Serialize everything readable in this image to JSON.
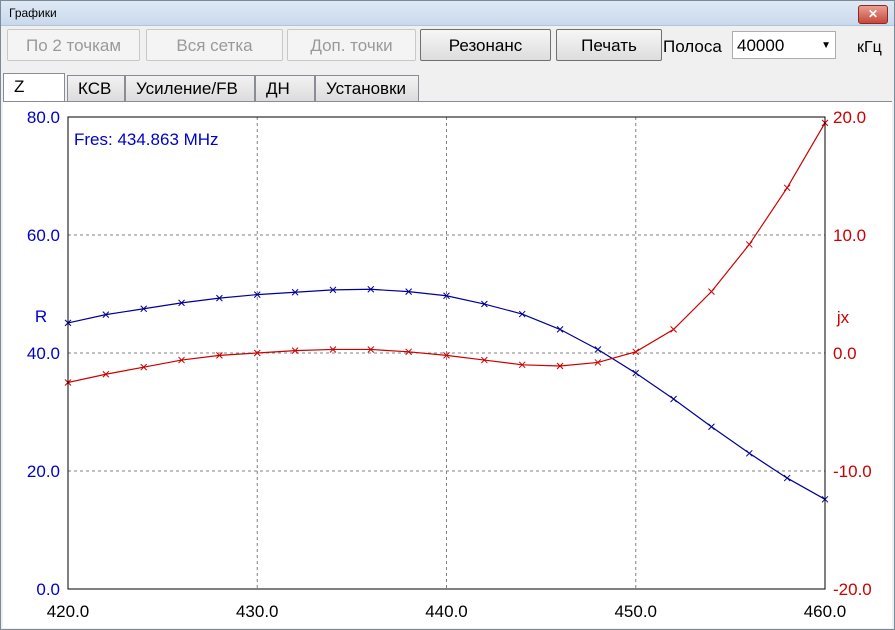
{
  "window": {
    "title": "Графики",
    "close_label": "✕"
  },
  "toolbar": {
    "btn_two_points": "По 2 точкам",
    "btn_full_grid": "Вся сетка",
    "btn_extra_points": "Доп. точки",
    "btn_resonance": "Резонанс",
    "btn_print": "Печать",
    "band_label": "Полоса",
    "band_value": "40000",
    "band_unit": "кГц"
  },
  "tabs": [
    "Z",
    "КСВ",
    "Усиление/FB",
    "ДН",
    "Установки"
  ],
  "colors": {
    "r_series": "#000099",
    "jx_series": "#cc0000",
    "left_axis": "#0000cc",
    "right_axis": "#cc0000",
    "grid": "#808080"
  },
  "chart_data": {
    "type": "line",
    "annotation": "Fres: 434.863 MHz",
    "x_ticks": [
      "420.0",
      "430.0",
      "440.0",
      "450.0",
      "460.0"
    ],
    "y_left_ticks": [
      "80.0",
      "60.0",
      "40.0",
      "20.0",
      "0.0"
    ],
    "y_right_ticks": [
      "20.0",
      "10.0",
      "0.0",
      "-10.0",
      "-20.0"
    ],
    "xlim": [
      420,
      460
    ],
    "ylim_left": [
      0,
      80
    ],
    "ylim_right": [
      -20,
      20
    ],
    "grid": true,
    "series": [
      {
        "name": "R",
        "axis": "left",
        "x": [
          420,
          422,
          424,
          426,
          428,
          430,
          432,
          434,
          436,
          438,
          440,
          442,
          444,
          446,
          448,
          450,
          452,
          454,
          456,
          458,
          460
        ],
        "values": [
          45.1,
          46.5,
          47.5,
          48.5,
          49.3,
          49.9,
          50.3,
          50.7,
          50.8,
          50.4,
          49.7,
          48.3,
          46.6,
          44.0,
          40.6,
          36.6,
          32.2,
          27.5,
          23.0,
          18.8,
          15.2
        ]
      },
      {
        "name": "jx",
        "axis": "right",
        "x": [
          420,
          422,
          424,
          426,
          428,
          430,
          432,
          434,
          436,
          438,
          440,
          442,
          444,
          446,
          448,
          450,
          452,
          454,
          456,
          458,
          460
        ],
        "values": [
          -2.5,
          -1.8,
          -1.2,
          -0.6,
          -0.2,
          0.0,
          0.2,
          0.3,
          0.3,
          0.1,
          -0.2,
          -0.6,
          -1.0,
          -1.1,
          -0.8,
          0.1,
          2.0,
          5.2,
          9.2,
          14.0,
          19.5
        ]
      }
    ]
  }
}
